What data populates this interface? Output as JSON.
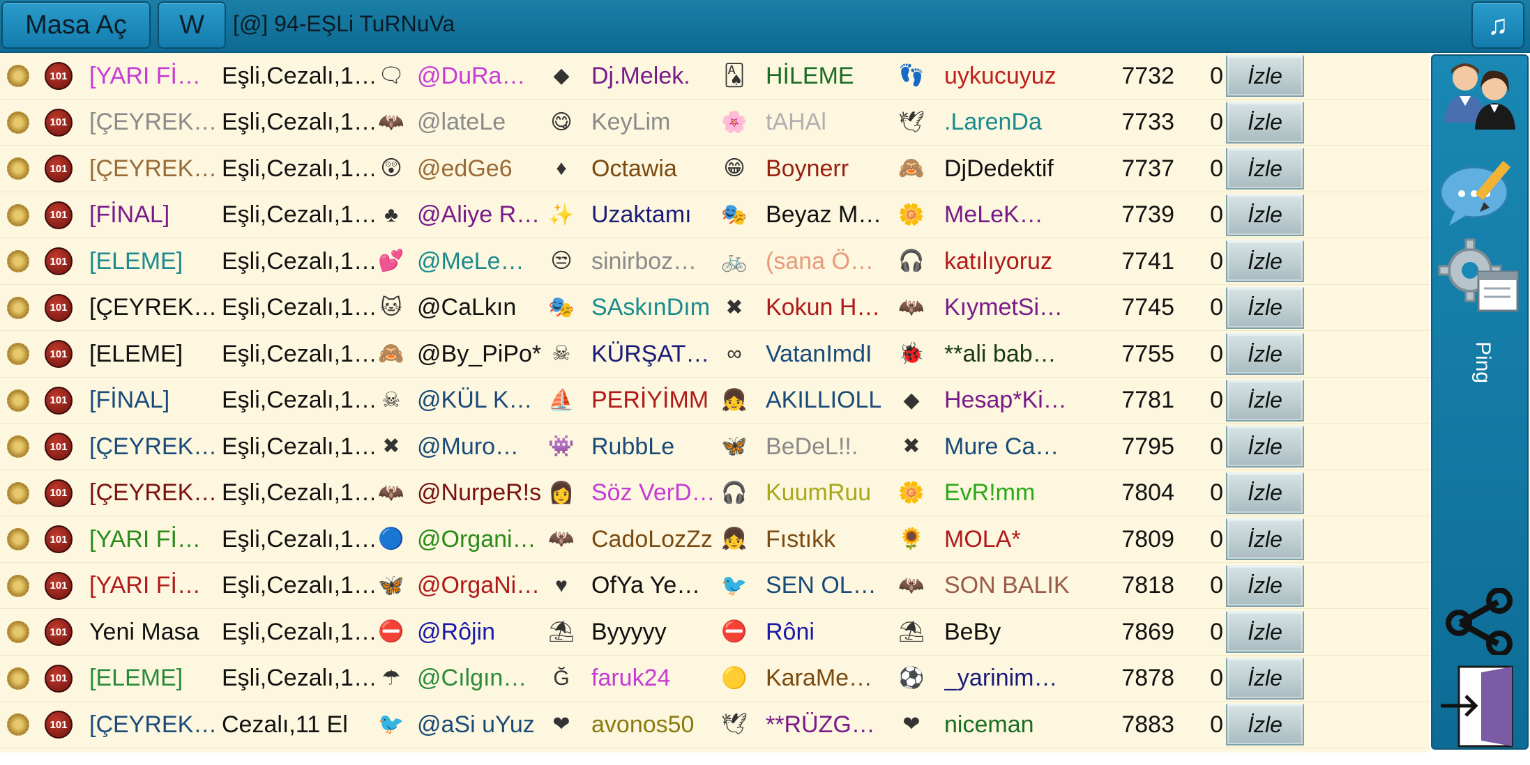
{
  "topbar": {
    "open_table_label": "Masa Aç",
    "w_label": "W",
    "room_title": "[@] 94-EŞLi TuRNuVa",
    "music_icon": "music-note-icon"
  },
  "sidebar": {
    "users_icon": "users-icon",
    "chat_icon": "chat-edit-icon",
    "settings_icon": "settings-window-icon",
    "ping_label": "Ping",
    "share_icon": "share-icon",
    "exit_icon": "exit-door-icon"
  },
  "table": {
    "badge_101": "101",
    "watch_label": "İzle",
    "rows": [
      {
        "name": "[YARI Fİ…",
        "name_color": "#c63ad6",
        "rules": "Eşli,Cezalı,1…",
        "i1": "speech-bubble-icon",
        "i1g": "🗨",
        "p1": "@DuRa…",
        "p1c": "#c63ad6",
        "i2": "red-diamond-icon",
        "i2g": "◆",
        "p2": "Dj.Melek.",
        "p2c": "#7a1a8a",
        "i3": "card-icon",
        "i3g": "🂡",
        "p3": "HİLEME",
        "p3c": "#1a6d22",
        "i4": "footprints-icon",
        "i4g": "👣",
        "p4": "uykucuyuz",
        "p4c": "#c0201b",
        "id": "7732",
        "count": "0"
      },
      {
        "name": "[ÇEYREK…",
        "name_color": "#8a8a8a",
        "rules": "Eşli,Cezalı,1…",
        "i1": "bat-icon",
        "i1g": "🦇",
        "p1": "@lateLe",
        "p1c": "#8a8a8a",
        "i2": "smiley-icon",
        "i2g": "😋",
        "p2": "KeyLim",
        "p2c": "#8a8a8a",
        "i3": "flower-icon",
        "i3g": "🌸",
        "p3": "tAHAl",
        "p3c": "#b0b0b0",
        "i4": "bird-icon",
        "i4g": "🕊",
        "p4": ".LarenDa",
        "p4c": "#1a8a8e",
        "id": "7733",
        "count": "0"
      },
      {
        "name": "[ÇEYREK…",
        "name_color": "#9a6a36",
        "rules": "Eşli,Cezalı,1…",
        "i1": "surprised-face-icon",
        "i1g": "😲",
        "p1": "@edGe6",
        "p1c": "#9a6a36",
        "i2": "red-diamond-icon",
        "i2g": "♦",
        "p2": "Octawia",
        "p2c": "#7a4a10",
        "i3": "laughing-face-icon",
        "i3g": "😁",
        "p3": "Boynerr",
        "p3c": "#9a2010",
        "i4": "face-icon",
        "i4g": "🙈",
        "p4": "DjDedektif",
        "p4c": "#111111",
        "id": "7737",
        "count": "0"
      },
      {
        "name": "[FİNAL]",
        "name_color": "#7a1a8a",
        "rules": "Eşli,Cezalı,1…",
        "i1": "club-icon",
        "i1g": "♣",
        "p1": "@Aliye R…",
        "p1c": "#7a1a8a",
        "i2": "star-fairy-icon",
        "i2g": "✨",
        "p2": "Uzaktamı",
        "p2c": "#1a1a7a",
        "i3": "masks-icon",
        "i3g": "🎭",
        "p3": "Beyaz M…",
        "p3c": "#111111",
        "i4": "flower-icon",
        "i4g": "🌼",
        "p4": "MeLeK…",
        "p4c": "#7a1a8a",
        "id": "7739",
        "count": "0"
      },
      {
        "name": "[ELEME]",
        "name_color": "#1a8a8e",
        "rules": "Eşli,Cezalı,1…",
        "i1": "hearts-icon",
        "i1g": "💕",
        "p1": "@MeLe…",
        "p1c": "#1a8a8e",
        "i2": "smug-face-icon",
        "i2g": "😒",
        "p2": "sinirboz…",
        "p2c": "#8a8a8a",
        "i3": "bicycle-icon",
        "i3g": "🚲",
        "p3": "(sana Ö…",
        "p3c": "#e89a7a",
        "i4": "headphones-icon",
        "i4g": "🎧",
        "p4": "katılıyoruz",
        "p4c": "#b01a1a",
        "id": "7741",
        "count": "0"
      },
      {
        "name": "[ÇEYREK…",
        "name_color": "#111111",
        "rules": "Eşli,Cezalı,1…",
        "i1": "cat-icon",
        "i1g": "🐱",
        "p1": "@CaLkın",
        "p1c": "#111111",
        "i2": "masks-icon",
        "i2g": "🎭",
        "p2": "SAskınDım",
        "p2c": "#1a8a8e",
        "i3": "red-x-icon",
        "i3g": "✖",
        "p3": "Kokun H…",
        "p3c": "#b01a1a",
        "i4": "bat-icon",
        "i4g": "🦇",
        "p4": "KıymetSi…",
        "p4c": "#7a1a8a",
        "id": "7745",
        "count": "0"
      },
      {
        "name": "[ELEME]",
        "name_color": "#111111",
        "rules": "Eşli,Cezalı,1…",
        "i1": "monkey-icon",
        "i1g": "🙈",
        "p1": "@By_PiPo*",
        "p1c": "#111111",
        "i2": "pirate-icon",
        "i2g": "☠",
        "p2": "KÜRŞAT…",
        "p2c": "#1a1a7a",
        "i3": "infinity-icon",
        "i3g": "∞",
        "p3": "VatanImdI",
        "p3c": "#1a4a7a",
        "i4": "ladybug-icon",
        "i4g": "🐞",
        "p4": "**ali bab…",
        "p4c": "#1a3a1a",
        "id": "7755",
        "count": "0"
      },
      {
        "name": "[FİNAL]",
        "name_color": "#1a4a7a",
        "rules": "Eşli,Cezalı,1…",
        "i1": "pirate-icon",
        "i1g": "☠",
        "p1": "@KÜL K…",
        "p1c": "#1a4a7a",
        "i2": "ship-icon",
        "i2g": "⛵",
        "p2": "PERİYİMM",
        "p2c": "#b01a1a",
        "i3": "girl-icon",
        "i3g": "👧",
        "p3": "AKILLIOLL",
        "p3c": "#1a4a7a",
        "i4": "red-diamond-icon",
        "i4g": "◆",
        "p4": "Hesap*Ki…",
        "p4c": "#7a1a8a",
        "id": "7781",
        "count": "0"
      },
      {
        "name": "[ÇEYREK…",
        "name_color": "#1a4a7a",
        "rules": "Eşli,Cezalı,1…",
        "i1": "red-x-icon",
        "i1g": "✖",
        "p1": "@Muro…",
        "p1c": "#1a4a7a",
        "i2": "monster-icon",
        "i2g": "👾",
        "p2": "RubbLe",
        "p2c": "#1a4a7a",
        "i3": "butterfly-icon",
        "i3g": "🦋",
        "p3": "BeDeL!!.",
        "p3c": "#8a8a8a",
        "i4": "red-x-icon",
        "i4g": "✖",
        "p4": "Mure Ca…",
        "p4c": "#1a4a7a",
        "id": "7795",
        "count": "0"
      },
      {
        "name": "[ÇEYREK…",
        "name_color": "#7a1010",
        "rules": "Eşli,Cezalı,1…",
        "i1": "bat-icon",
        "i1g": "🦇",
        "p1": "@NurpeR!s",
        "p1c": "#7a1010",
        "i2": "woman-icon",
        "i2g": "👩",
        "p2": "Söz VerD…",
        "p2c": "#c63ad6",
        "i3": "headphones-icon",
        "i3g": "🎧",
        "p3": "KuumRuu",
        "p3c": "#a8a81a",
        "i4": "flower-icon",
        "i4g": "🌼",
        "p4": "EvR!mm",
        "p4c": "#2aa81a",
        "id": "7804",
        "count": "0"
      },
      {
        "name": "[YARI Fİ…",
        "name_color": "#2a8a1a",
        "rules": "Eşli,Cezalı,1…",
        "i1": "blue-circle-icon",
        "i1g": "🔵",
        "p1": "@Organi…",
        "p1c": "#2a8a1a",
        "i2": "bat-icon",
        "i2g": "🦇",
        "p2": "CadoLozZz",
        "p2c": "#7a4a10",
        "i3": "girl-icon",
        "i3g": "👧",
        "p3": "Fıstıkk",
        "p3c": "#7a4a10",
        "i4": "sunflower-icon",
        "i4g": "🌻",
        "p4": "MOLA*",
        "p4c": "#b01a1a",
        "id": "7809",
        "count": "0"
      },
      {
        "name": "[YARI Fİ…",
        "name_color": "#b01a1a",
        "rules": "Eşli,Cezalı,1…",
        "i1": "butterfly-icon",
        "i1g": "🦋",
        "p1": "@OrgaNi…",
        "p1c": "#b01a1a",
        "i2": "heart-icon",
        "i2g": "♥",
        "p2": "OfYa Ye…",
        "p2c": "#111111",
        "i3": "angry-bird-icon",
        "i3g": "🐦",
        "p3": "SEN OL…",
        "p3c": "#1a4a7a",
        "i4": "bat-icon",
        "i4g": "🦇",
        "p4": "SON BALIK",
        "p4c": "#9a5a4a",
        "id": "7818",
        "count": "0"
      },
      {
        "name": "Yeni Masa",
        "name_color": "#111111",
        "rules": "Eşli,Cezalı,1…",
        "i1": "no-entry-icon",
        "i1g": "⛔",
        "p1": "@Rôjin",
        "p1c": "#1a1aa8",
        "i2": "umbrella-icon",
        "i2g": "⛱",
        "p2": "Byyyyy",
        "p2c": "#111111",
        "i3": "no-entry-icon",
        "i3g": "⛔",
        "p3": "Rôni",
        "p3c": "#1a1aa8",
        "i4": "umbrella-icon",
        "i4g": "⛱",
        "p4": "BeBy",
        "p4c": "#111111",
        "id": "7869",
        "count": "0"
      },
      {
        "name": "[ELEME]",
        "name_color": "#2a8a3a",
        "rules": "Eşli,Cezalı,1…",
        "i1": "umbrella-icon",
        "i1g": "☂",
        "p1": "@Cılgın…",
        "p1c": "#2a8a3a",
        "i2": "g-letter-icon",
        "i2g": "Ğ",
        "p2": "faruk24",
        "p2c": "#c63ad6",
        "i3": "yellow-circle-icon",
        "i3g": "🟡",
        "p3": "KaraMe…",
        "p3c": "#7a4a10",
        "i4": "team-badge-icon",
        "i4g": "⚽",
        "p4": "_yarinim…",
        "p4c": "#1a1a7a",
        "id": "7878",
        "count": "0"
      },
      {
        "name": "[ÇEYREK…",
        "name_color": "#1a4a7a",
        "rules": "Cezalı,11 El",
        "i1": "bluebird-icon",
        "i1g": "🐦",
        "p1": "@aSi uYuz",
        "p1c": "#1a4a7a",
        "i2": "heart-icon",
        "i2g": "❤",
        "p2": "avonos50",
        "p2c": "#8a7a10",
        "i3": "bird-icon",
        "i3g": "🕊",
        "p3": "**RÜZG…",
        "p3c": "#7a1a8a",
        "i4": "heart-icon",
        "i4g": "❤",
        "p4": "niceman",
        "p4c": "#1a6d22",
        "id": "7883",
        "count": "0"
      }
    ]
  }
}
